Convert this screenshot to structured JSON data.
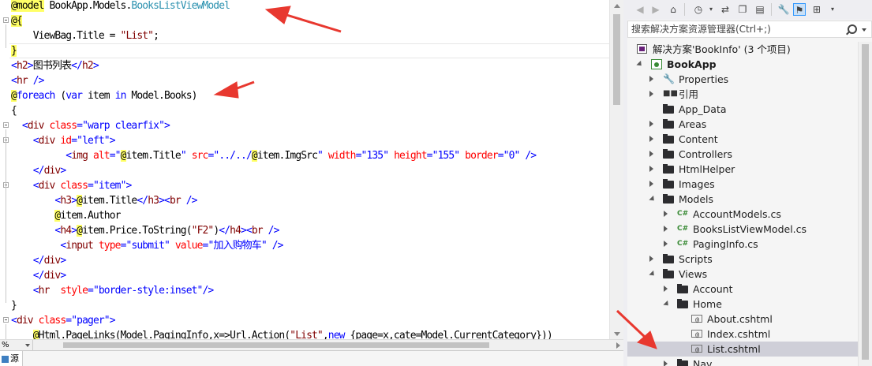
{
  "editor": {
    "lines": [
      [
        [
          "razor",
          "@model"
        ],
        [
          "mth",
          " BookApp.Models."
        ],
        [
          "typ",
          "BooksListViewModel"
        ]
      ],
      [
        [
          "razor",
          "@{"
        ]
      ],
      [
        [
          "mth",
          "    ViewBag.Title = "
        ],
        [
          "tag",
          "\"List\""
        ],
        [
          "mth",
          ";"
        ]
      ],
      [
        [
          "razor",
          "}"
        ]
      ],
      [
        [
          "kw",
          "<"
        ],
        [
          "tag",
          "h2"
        ],
        [
          "kw",
          ">"
        ],
        [
          "mth",
          "图书列表"
        ],
        [
          "kw",
          "</"
        ],
        [
          "tag",
          "h2"
        ],
        [
          "kw",
          ">"
        ]
      ],
      [
        [
          "kw",
          "<"
        ],
        [
          "tag",
          "hr"
        ],
        [
          "kw",
          " />"
        ]
      ],
      [
        [
          "razor",
          "@"
        ],
        [
          "kw",
          "foreach"
        ],
        [
          "mth",
          " ("
        ],
        [
          "kw",
          "var"
        ],
        [
          "mth",
          " item "
        ],
        [
          "kw",
          "in"
        ],
        [
          "mth",
          " Model.Books)"
        ]
      ],
      [
        [
          "mth",
          "{"
        ]
      ],
      [
        [
          "mth",
          "  "
        ],
        [
          "kw",
          "<"
        ],
        [
          "tag",
          "div"
        ],
        [
          "mth",
          " "
        ],
        [
          "attr",
          "class"
        ],
        [
          "kw",
          "="
        ],
        [
          "str",
          "\"warp clearfix\""
        ],
        [
          "kw",
          ">"
        ]
      ],
      [
        [
          "mth",
          "    "
        ],
        [
          "kw",
          "<"
        ],
        [
          "tag",
          "div"
        ],
        [
          "mth",
          " "
        ],
        [
          "attr",
          "id"
        ],
        [
          "kw",
          "="
        ],
        [
          "str",
          "\"left\""
        ],
        [
          "kw",
          ">"
        ]
      ],
      [
        [
          "mth",
          "          "
        ],
        [
          "kw",
          "<"
        ],
        [
          "tag",
          "img"
        ],
        [
          "mth",
          " "
        ],
        [
          "attr",
          "alt"
        ],
        [
          "kw",
          "="
        ],
        [
          "str",
          "\""
        ],
        [
          "razor",
          "@"
        ],
        [
          "mth",
          "item.Title"
        ],
        [
          "str",
          "\""
        ],
        [
          "mth",
          " "
        ],
        [
          "attr",
          "src"
        ],
        [
          "kw",
          "="
        ],
        [
          "str",
          "\"../../"
        ],
        [
          "razor",
          "@"
        ],
        [
          "mth",
          "item.ImgSrc"
        ],
        [
          "str",
          "\""
        ],
        [
          "mth",
          " "
        ],
        [
          "attr",
          "width"
        ],
        [
          "kw",
          "="
        ],
        [
          "str",
          "\"135\""
        ],
        [
          "mth",
          " "
        ],
        [
          "attr",
          "height"
        ],
        [
          "kw",
          "="
        ],
        [
          "str",
          "\"155\""
        ],
        [
          "mth",
          " "
        ],
        [
          "attr",
          "border"
        ],
        [
          "kw",
          "="
        ],
        [
          "str",
          "\"0\""
        ],
        [
          "kw",
          " />"
        ]
      ],
      [
        [
          "mth",
          "    "
        ],
        [
          "kw",
          "</"
        ],
        [
          "tag",
          "div"
        ],
        [
          "kw",
          ">"
        ]
      ],
      [
        [
          "mth",
          "    "
        ],
        [
          "kw",
          "<"
        ],
        [
          "tag",
          "div"
        ],
        [
          "mth",
          " "
        ],
        [
          "attr",
          "class"
        ],
        [
          "kw",
          "="
        ],
        [
          "str",
          "\"item\""
        ],
        [
          "kw",
          ">"
        ]
      ],
      [
        [
          "mth",
          "        "
        ],
        [
          "kw",
          "<"
        ],
        [
          "tag",
          "h3"
        ],
        [
          "kw",
          ">"
        ],
        [
          "razor",
          "@"
        ],
        [
          "mth",
          "item.Title"
        ],
        [
          "kw",
          "</"
        ],
        [
          "tag",
          "h3"
        ],
        [
          "kw",
          "><"
        ],
        [
          "tag",
          "br"
        ],
        [
          "kw",
          " />"
        ]
      ],
      [
        [
          "mth",
          "        "
        ],
        [
          "razor",
          "@"
        ],
        [
          "mth",
          "item.Author"
        ]
      ],
      [
        [
          "mth",
          "        "
        ],
        [
          "kw",
          "<"
        ],
        [
          "tag",
          "h4"
        ],
        [
          "kw",
          ">"
        ],
        [
          "razor",
          "@"
        ],
        [
          "mth",
          "item.Price.ToString("
        ],
        [
          "tag",
          "\"F2\""
        ],
        [
          "mth",
          ")"
        ],
        [
          "kw",
          "</"
        ],
        [
          "tag",
          "h4"
        ],
        [
          "kw",
          "><"
        ],
        [
          "tag",
          "br"
        ],
        [
          "kw",
          " />"
        ]
      ],
      [
        [
          "mth",
          "         "
        ],
        [
          "kw",
          "<"
        ],
        [
          "tag",
          "input"
        ],
        [
          "mth",
          " "
        ],
        [
          "attr",
          "type"
        ],
        [
          "kw",
          "="
        ],
        [
          "str",
          "\"submit\""
        ],
        [
          "mth",
          " "
        ],
        [
          "attr",
          "value"
        ],
        [
          "kw",
          "="
        ],
        [
          "str",
          "\"加入购物车\""
        ],
        [
          "kw",
          " />"
        ]
      ],
      [
        [
          "mth",
          "    "
        ],
        [
          "kw",
          "</"
        ],
        [
          "tag",
          "div"
        ],
        [
          "kw",
          ">"
        ]
      ],
      [
        [
          "mth",
          "    "
        ],
        [
          "kw",
          "</"
        ],
        [
          "tag",
          "div"
        ],
        [
          "kw",
          ">"
        ]
      ],
      [
        [
          "mth",
          "    "
        ],
        [
          "kw",
          "<"
        ],
        [
          "tag",
          "hr"
        ],
        [
          "mth",
          "  "
        ],
        [
          "attr",
          "style"
        ],
        [
          "kw",
          "="
        ],
        [
          "str",
          "\"border-style:inset\""
        ],
        [
          "kw",
          "/>"
        ]
      ],
      [
        [
          "mth",
          "}"
        ]
      ],
      [
        [
          "kw",
          "<"
        ],
        [
          "tag",
          "div"
        ],
        [
          "mth",
          " "
        ],
        [
          "attr",
          "class"
        ],
        [
          "kw",
          "="
        ],
        [
          "str",
          "\"pager\""
        ],
        [
          "kw",
          ">"
        ]
      ],
      [
        [
          "mth",
          "    "
        ],
        [
          "razor",
          "@"
        ],
        [
          "mth",
          "Html.PageLinks(Model.PagingInfo,x=>Url.Action("
        ],
        [
          "tag",
          "\"List\""
        ],
        [
          "mth",
          ","
        ],
        [
          "kw",
          "new"
        ],
        [
          "mth",
          " {page=x,cate=Model.CurrentCategory}))"
        ]
      ]
    ],
    "zoom": "%",
    "source_tab": "源"
  },
  "solution_explorer": {
    "search_placeholder": "搜索解决方案资源管理器(Ctrl+;)",
    "toolbar_icons": [
      "back-icon",
      "forward-icon",
      "home-icon",
      "history-icon",
      "dropdown-icon",
      "sync-icon",
      "collapse-all-icon",
      "show-all-files-icon",
      "properties-icon",
      "preview-icon",
      "diagram-icon",
      "dropdown-icon"
    ],
    "nodes": [
      {
        "label": "解决方案'BookInfo' (3 个项目)",
        "level": 0,
        "icon": "sol",
        "expander": "none",
        "bold": false
      },
      {
        "label": "BookApp",
        "level": 0,
        "icon": "proj",
        "expander": "open",
        "bold": true
      },
      {
        "label": "Properties",
        "level": 1,
        "icon": "wrench",
        "expander": "closed",
        "bold": false
      },
      {
        "label": "引用",
        "level": 1,
        "icon": "refs",
        "expander": "closed",
        "bold": false
      },
      {
        "label": "App_Data",
        "level": 1,
        "icon": "folder",
        "expander": "none",
        "bold": false
      },
      {
        "label": "Areas",
        "level": 1,
        "icon": "folder",
        "expander": "closed",
        "bold": false
      },
      {
        "label": "Content",
        "level": 1,
        "icon": "folder",
        "expander": "closed",
        "bold": false
      },
      {
        "label": "Controllers",
        "level": 1,
        "icon": "folder",
        "expander": "closed",
        "bold": false
      },
      {
        "label": "HtmlHelper",
        "level": 1,
        "icon": "folder",
        "expander": "closed",
        "bold": false
      },
      {
        "label": "Images",
        "level": 1,
        "icon": "folder",
        "expander": "closed",
        "bold": false
      },
      {
        "label": "Models",
        "level": 1,
        "icon": "folder",
        "expander": "open",
        "bold": false
      },
      {
        "label": "AccountModels.cs",
        "level": 2,
        "icon": "cs",
        "expander": "closed",
        "bold": false
      },
      {
        "label": "BooksListViewModel.cs",
        "level": 2,
        "icon": "cs",
        "expander": "closed",
        "bold": false
      },
      {
        "label": "PagingInfo.cs",
        "level": 2,
        "icon": "cs",
        "expander": "closed",
        "bold": false
      },
      {
        "label": "Scripts",
        "level": 1,
        "icon": "folder",
        "expander": "closed",
        "bold": false
      },
      {
        "label": "Views",
        "level": 1,
        "icon": "folder",
        "expander": "open",
        "bold": false
      },
      {
        "label": "Account",
        "level": 2,
        "icon": "folder",
        "expander": "closed",
        "bold": false
      },
      {
        "label": "Home",
        "level": 2,
        "icon": "folder",
        "expander": "open",
        "bold": false
      },
      {
        "label": "About.cshtml",
        "level": 3,
        "icon": "cshtml",
        "expander": "none",
        "bold": false
      },
      {
        "label": "Index.cshtml",
        "level": 3,
        "icon": "cshtml",
        "expander": "none",
        "bold": false
      },
      {
        "label": "List.cshtml",
        "level": 3,
        "icon": "cshtml",
        "expander": "none",
        "bold": false,
        "selected": true
      },
      {
        "label": "Nav",
        "level": 2,
        "icon": "folder",
        "expander": "closed",
        "bold": false
      }
    ]
  },
  "colors": {
    "annotation_arrow": "#e8382f",
    "selection": "#cfcfd8",
    "razor_highlight": "#ffff66"
  }
}
